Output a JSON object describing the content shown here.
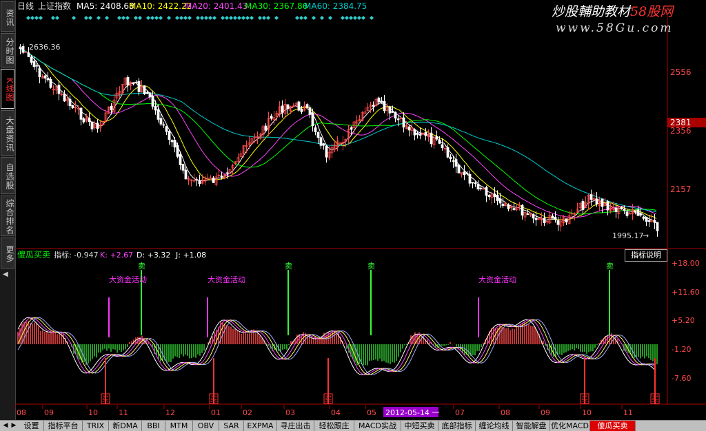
{
  "sidebar": {
    "items": [
      {
        "label": "资讯",
        "active": false
      },
      {
        "label": "分时图",
        "active": false
      },
      {
        "label": "K线图",
        "active": true
      },
      {
        "label": "大盘资讯",
        "active": false
      },
      {
        "label": "自选股",
        "active": false
      },
      {
        "label": "综合排名",
        "active": false
      },
      {
        "label": "更多",
        "active": false
      }
    ]
  },
  "header": {
    "period": "日线",
    "index_name": "上证指数",
    "ma5": "MA5: 2408.68",
    "ma10": "MA10: 2422.22",
    "ma20": "MA20: 2401.43",
    "ma30": "MA30: 2367.86",
    "ma60": "MA60: 2384.75"
  },
  "watermark": {
    "text_white": "炒股輔助教材",
    "text_red": "58股网",
    "url": "www.58Gu.com"
  },
  "price_axis": {
    "ticks": [
      "2556",
      "2356",
      "2157"
    ],
    "current_price": "2381",
    "high_label": "2636.36",
    "low_label": "1995.17"
  },
  "indicator": {
    "name": "傻瓜买卖",
    "k_label": "指标: -0.947",
    "k2_label": "K: +2.67",
    "d_label": "D: +3.32",
    "j_label": "J: +1.08",
    "help_button": "指标说明",
    "axis_ticks": [
      "+18.00",
      "+11.60",
      "+5.20",
      "-1.20",
      "-7.60"
    ],
    "sell_label": "卖",
    "buy_label": "买",
    "fund_label": "大资金活动"
  },
  "date_axis": {
    "labels": [
      "08",
      "09",
      "10",
      "11",
      "12",
      "01",
      "02",
      "03",
      "04",
      "05",
      "07",
      "08",
      "09",
      "10",
      "11"
    ],
    "cursor_date": "2012-05-14 一"
  },
  "bottom_tabs": [
    {
      "label": "设置",
      "active": false
    },
    {
      "label": "指标平台",
      "active": false
    },
    {
      "label": "TRIX",
      "active": false
    },
    {
      "label": "新DMA",
      "active": false
    },
    {
      "label": "BBI",
      "active": false
    },
    {
      "label": "MTM",
      "active": false
    },
    {
      "label": "OBV",
      "active": false
    },
    {
      "label": "SAR",
      "active": false
    },
    {
      "label": "EXPMA",
      "active": false
    },
    {
      "label": "寻庄出击",
      "active": false
    },
    {
      "label": "轻松跟庄",
      "active": false
    },
    {
      "label": "MACD实战",
      "active": false
    },
    {
      "label": "中短买卖",
      "active": false
    },
    {
      "label": "底部指标",
      "active": false
    },
    {
      "label": "缠论均线",
      "active": false
    },
    {
      "label": "智能解盘",
      "active": false
    },
    {
      "label": "优化MACD",
      "active": false
    },
    {
      "label": "傻瓜买卖",
      "active": true
    }
  ],
  "colors": {
    "up": "#ff4a4a",
    "down": "#ffffff",
    "ma5": "#ffffff",
    "ma10": "#ffff00",
    "ma20": "#ff44ff",
    "ma30": "#00ff00",
    "ma60": "#00cccc",
    "sell_line": "#33ff33",
    "fund_line": "#ff33ff",
    "buy_line": "#ff3333",
    "accent": "#cc0000"
  }
}
